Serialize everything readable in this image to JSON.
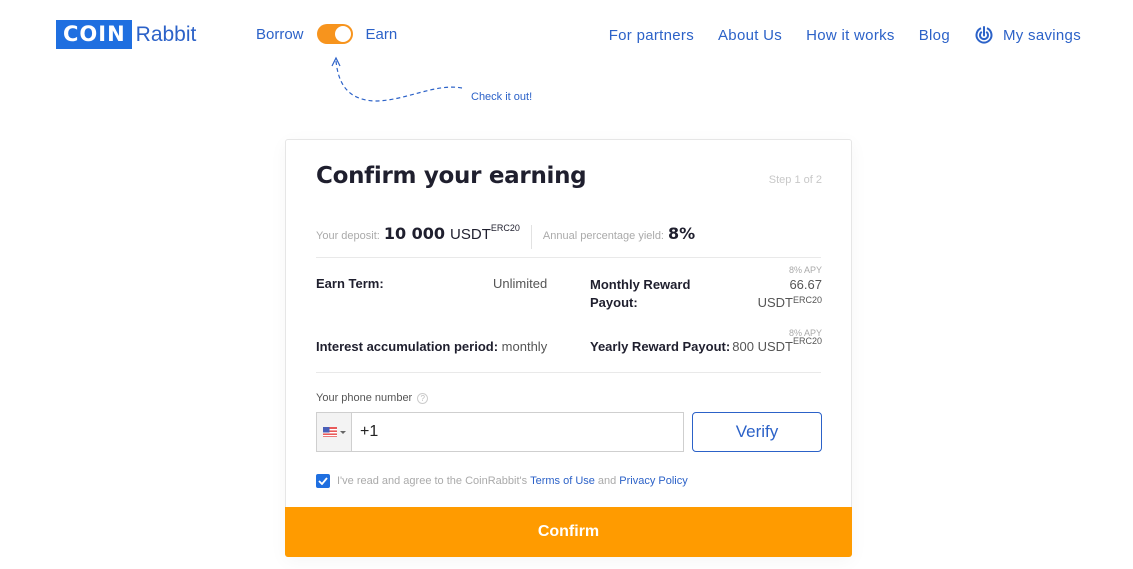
{
  "header": {
    "logo": {
      "part1": "COIN",
      "part2": "Rabbit"
    },
    "mode_toggle": {
      "left_label": "Borrow",
      "right_label": "Earn",
      "selected": "Earn"
    },
    "hint": "Check it out!",
    "nav": [
      {
        "label": "For partners"
      },
      {
        "label": "About Us"
      },
      {
        "label": "How it works"
      },
      {
        "label": "Blog"
      }
    ],
    "savings": {
      "label": "My savings",
      "icon": "savings-dial-icon"
    }
  },
  "card": {
    "title": "Confirm your earning",
    "step": "Step 1 of 2",
    "deposit": {
      "label": "Your deposit:",
      "amount": "10 000",
      "currency": "USDT",
      "network": "ERC20"
    },
    "apy": {
      "label": "Annual percentage yield:",
      "value": "8%"
    },
    "details": {
      "earn_term": {
        "label": "Earn Term:",
        "value": "Unlimited"
      },
      "monthly": {
        "label_line1": "Monthly Reward",
        "label_line2": "Payout:",
        "apy_note": "8% APY",
        "amount": "66.67",
        "currency": "USDT",
        "network": "ERC20"
      },
      "interest_period": {
        "label": "Interest accumulation period:",
        "value": "monthly"
      },
      "yearly": {
        "label": "Yearly Reward Payout:",
        "apy_note": "8% APY",
        "amount": "800",
        "currency": "USDT",
        "network": "ERC20"
      }
    },
    "phone": {
      "label": "Your phone number",
      "help_icon": "?",
      "country": "US",
      "value": "+1",
      "placeholder": ""
    },
    "verify_label": "Verify",
    "agreement": {
      "checked": true,
      "text": "I've read and agree to the CoinRabbit's",
      "terms": "Terms of Use",
      "and": "and",
      "privacy": "Privacy Policy"
    },
    "confirm_label": "Confirm"
  },
  "colors": {
    "brand_blue": "#1f6fe0",
    "link_blue": "#2c62c8",
    "accent_orange": "#ff9b00",
    "toggle_orange": "#f7941d"
  }
}
